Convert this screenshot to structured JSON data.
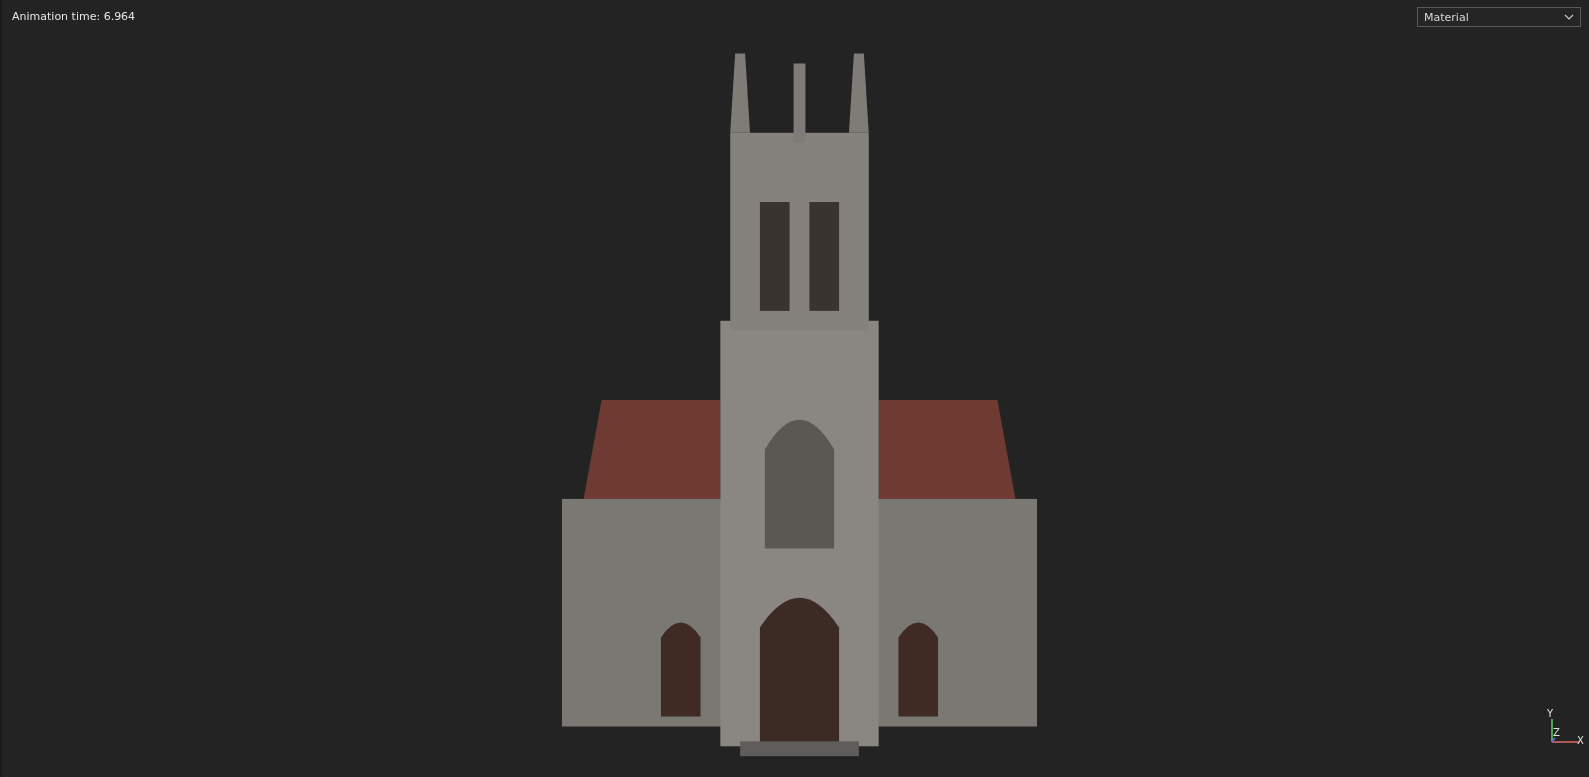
{
  "viewport": {
    "animation_time": "Animation time: 6.964"
  },
  "shading_dropdown": {
    "value": "Material"
  },
  "axis_gizmo": {
    "x_label": "X",
    "y_label": "Y",
    "z_label": "Z"
  }
}
